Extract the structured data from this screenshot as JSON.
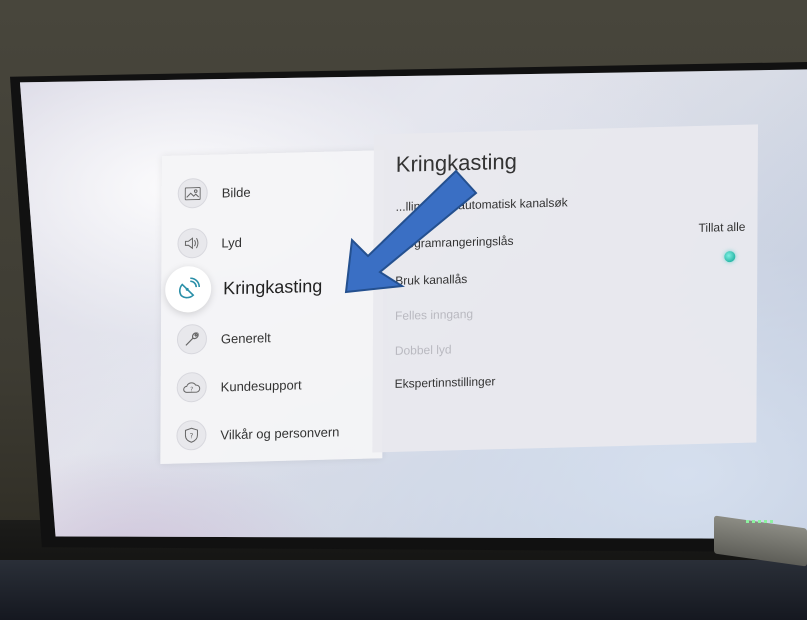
{
  "sidebar": {
    "items": [
      {
        "label": "Bilde",
        "icon": "picture-icon"
      },
      {
        "label": "Lyd",
        "icon": "speaker-icon"
      },
      {
        "label": "Kringkasting",
        "icon": "satellite-dish-icon"
      },
      {
        "label": "Generelt",
        "icon": "wrench-icon"
      },
      {
        "label": "Kundesupport",
        "icon": "support-cloud-icon"
      },
      {
        "label": "Vilkår og personvern",
        "icon": "shield-icon"
      }
    ],
    "selected": "Kringkasting"
  },
  "content": {
    "title": "Kringkasting",
    "rows": [
      {
        "label": "Innstillinger for automatisk kanalsøk",
        "visible_label": "...llinger for automatisk kanalsøk",
        "enabled": true
      },
      {
        "label": "Programrangeringslås",
        "value": "Tillat alle",
        "enabled": true
      },
      {
        "label": "Bruk kanallås",
        "toggle": "on",
        "enabled": true
      },
      {
        "label": "Felles inngang",
        "enabled": false
      },
      {
        "label": "Dobbel lyd",
        "enabled": false
      },
      {
        "label": "Ekspertinnstillinger",
        "enabled": true
      }
    ]
  },
  "colors": {
    "accent": "#2a8fa8",
    "toggle_on": "#2bb8a8",
    "arrow": "#3a6fc4"
  }
}
